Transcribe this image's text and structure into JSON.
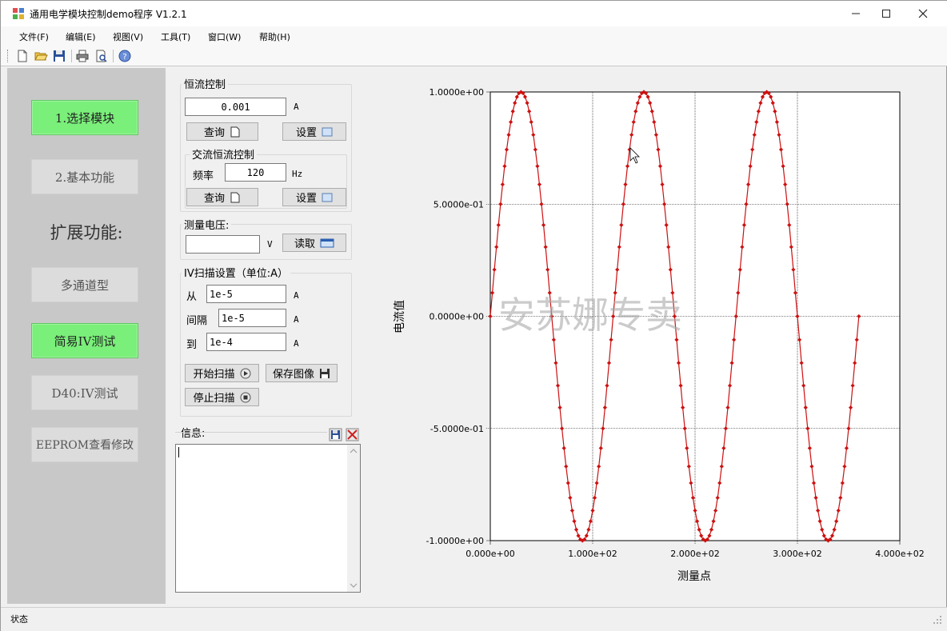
{
  "window": {
    "title": "通用电学模块控制demo程序 V1.2.1",
    "minimize_icon": "minimize-icon",
    "maximize_icon": "maximize-icon",
    "close_icon": "close-icon"
  },
  "menu": [
    "文件(F)",
    "编辑(E)",
    "视图(V)",
    "工具(T)",
    "窗口(W)",
    "帮助(H)"
  ],
  "toolbar_icons": [
    "new-file-icon",
    "open-folder-icon",
    "save-icon",
    "print-icon",
    "print-preview-icon",
    "about-icon"
  ],
  "nav": {
    "select_module": "1.选择模块",
    "basic_functions": "2.基本功能",
    "extended_label": "扩展功能:",
    "multichannel": "多通道型",
    "simple_iv": "简易IV测试",
    "d40_iv": "D40:IV测试",
    "eeprom": "EEPROM查看修改",
    "active_color": "#7aef7a"
  },
  "constant_current": {
    "title": "恒流控制",
    "value": "0.001",
    "unit": "A",
    "query_label": "查询",
    "set_label": "设置",
    "ac": {
      "title": "交流恒流控制",
      "freq_label": "频率",
      "freq_value": "120",
      "freq_unit": "Hz",
      "query_label": "查询",
      "set_label": "设置"
    }
  },
  "voltage": {
    "title": "测量电压:",
    "value": "",
    "unit": "V",
    "read_label": "读取"
  },
  "iv_scan": {
    "title": "IV扫描设置（单位:A）",
    "from_label": "从",
    "from_value": "1e-5",
    "step_label": "间隔",
    "step_value": "1e-5",
    "to_label": "到",
    "to_value": "1e-4",
    "unit": "A",
    "start_label": "开始扫描",
    "save_label": "保存图像",
    "stop_label": "停止扫描"
  },
  "info": {
    "title": "信息:",
    "content": ""
  },
  "status": {
    "text": "状态"
  },
  "chart_data": {
    "type": "scatter",
    "title": "",
    "xlabel": "测量点",
    "ylabel": "电流值",
    "xlim": [
      0,
      400
    ],
    "ylim": [
      -1,
      1
    ],
    "x_ticks": [
      "0.000e+00",
      "1.000e+02",
      "2.000e+02",
      "3.000e+02",
      "4.000e+02"
    ],
    "y_ticks": [
      "1.0000e+00",
      "5.0000e-01",
      "0.0000e+00",
      "-5.0000e-01",
      "-1.0000e+00"
    ],
    "grid": true,
    "watermark": "安苏娜专卖",
    "series": [
      {
        "color": "#cc1111",
        "function": "sin(2*pi*3*x/360)",
        "x_start": 0,
        "x_end": 360,
        "x_step": 2
      }
    ]
  }
}
